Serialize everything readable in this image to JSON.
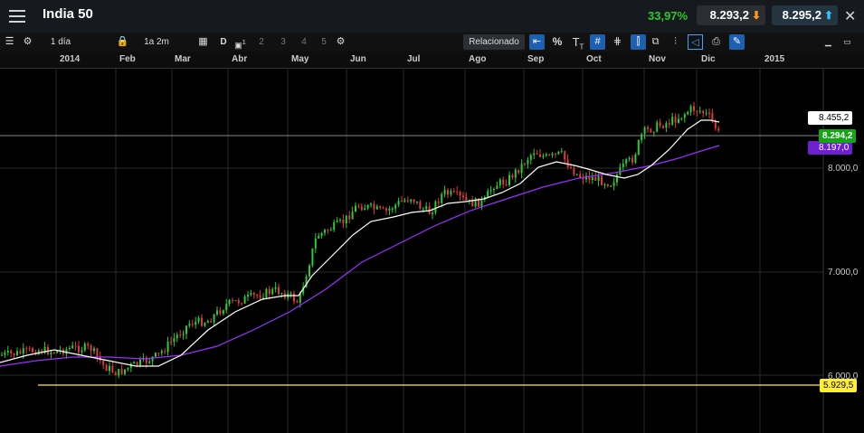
{
  "header": {
    "title": "India 50",
    "change": "33,97%",
    "sell_price": "8.293,2",
    "buy_price": "8.295,2",
    "sell_arrow": "down-arrow-icon",
    "buy_arrow": "up-arrow-icon"
  },
  "toolbar": {
    "interval": "1 día",
    "range": "1a 2m",
    "d_label": "D",
    "chart_count_label": "1",
    "nums": [
      "2",
      "3",
      "4",
      "5"
    ],
    "related": "Relacionado",
    "percent": "%",
    "text_tool": "T",
    "text_tool_sub": "T"
  },
  "chart": {
    "months": [
      "2014",
      "Feb",
      "Mar",
      "Abr",
      "May",
      "Jun",
      "Jul",
      "Ago",
      "Sep",
      "Oct",
      "Nov",
      "Dic",
      "2015"
    ],
    "y_labels": [
      "8.000,0",
      "7.000,0",
      "6.000,0"
    ],
    "tags": {
      "high": "8.455,2",
      "last": "8.294,2",
      "ma": "8.197,0",
      "low": "5.929,5"
    },
    "colors": {
      "up": "#2ecc2e",
      "down": "#e23a3a",
      "ma_short": "#ffffff",
      "ma_long": "#9b30ff",
      "low_line": "#ffee33"
    }
  }
}
